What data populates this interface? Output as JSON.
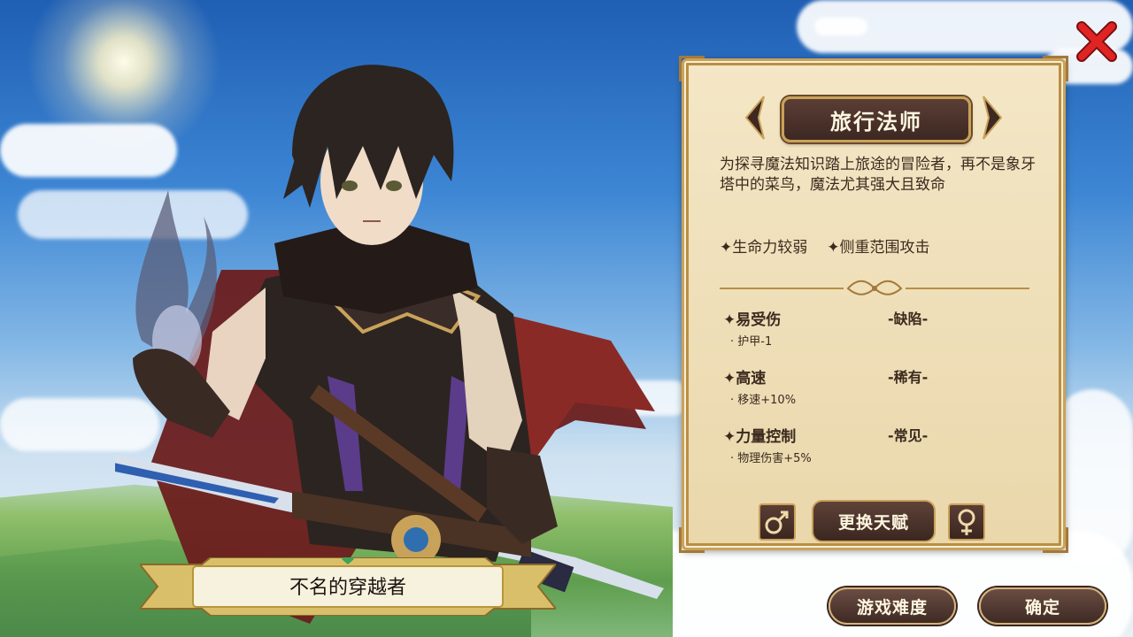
{
  "screen": "character-select",
  "colors": {
    "panel_bg": "#efdfb9",
    "panel_border": "#c9a25a",
    "button_bg": "#4a322a",
    "close_red": "#d11f1f",
    "text_dark": "#3b2a1e"
  },
  "character": {
    "class_name": "旅行法师",
    "description": "为探寻魔法知识踏上旅途的冒险者，再不是象牙塔中的菜鸟，魔法尤其强大且致命",
    "traits": [
      "✦生命力较弱",
      "✦侧重范围攻击"
    ],
    "perks": [
      {
        "name": "✦易受伤",
        "tag": "-缺陷-",
        "effect": "· 护甲-1"
      },
      {
        "name": "✦高速",
        "tag": "-稀有-",
        "effect": "· 移速+10%"
      },
      {
        "name": "✦力量控制",
        "tag": "-常见-",
        "effect": "· 物理伤害+5%"
      }
    ],
    "player_name": "不名的穿越者"
  },
  "buttons": {
    "change_talent": "更换天赋",
    "difficulty": "游戏难度",
    "confirm": "确定"
  },
  "icons": {
    "close": "close-x-icon",
    "prev": "chevron-left-icon",
    "next": "chevron-right-icon",
    "male": "male-symbol-icon",
    "female": "female-symbol-icon"
  }
}
